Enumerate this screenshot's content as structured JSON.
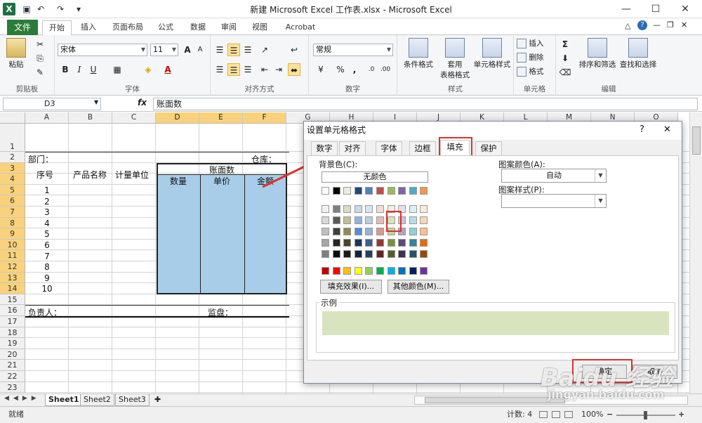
{
  "window": {
    "title": "新建 Microsoft Excel 工作表.xlsx - Microsoft Excel",
    "logo": "X",
    "min": "—",
    "max": "☐",
    "close": "✕"
  },
  "ribbon_tabs": [
    "文件",
    "开始",
    "插入",
    "页面布局",
    "公式",
    "数据",
    "审阅",
    "视图",
    "Acrobat"
  ],
  "ribbon": {
    "clipboard": {
      "paste": "粘贴",
      "label": "剪贴板"
    },
    "font": {
      "name": "宋体",
      "size": "11",
      "label": "字体",
      "bold": "B",
      "italic": "I",
      "underline": "U",
      "grow": "A",
      "shrink": "A",
      "fontcolor": "A"
    },
    "align": {
      "label": "对齐方式"
    },
    "number": {
      "format": "常规",
      "label": "数字",
      "percent": "%",
      "comma": ","
    },
    "styles": {
      "cond": "条件格式",
      "table1": "套用",
      "table2": "表格格式",
      "cell": "单元格样式",
      "label": "样式"
    },
    "cells": {
      "insert": "插入",
      "delete": "删除",
      "format": "格式",
      "label": "单元格"
    },
    "editing": {
      "sigma": "Σ",
      "sort": "排序和筛选",
      "find": "查找和选择",
      "label": "编辑"
    }
  },
  "formula_bar": {
    "name": "D3",
    "fx": "fx",
    "value": "账面数"
  },
  "columns": [
    "A",
    "B",
    "C",
    "D",
    "E",
    "F",
    "G",
    "H",
    "I",
    "J",
    "K",
    "L",
    "M",
    "N",
    "O"
  ],
  "rows": [
    "1",
    "2",
    "3",
    "4",
    "5",
    "6",
    "7",
    "8",
    "9",
    "10",
    "11",
    "12",
    "13",
    "14",
    "15",
    "16",
    "17",
    "18",
    "19",
    "20",
    "21",
    "22",
    "23"
  ],
  "sheet": {
    "dept": "部门：",
    "warehouse": "仓库：",
    "seq": "序号",
    "product": "产品名称",
    "unit": "计量单位",
    "book": "账面数",
    "qty": "数量",
    "price": "单价",
    "amount": "金额",
    "numbers": [
      "1",
      "2",
      "3",
      "4",
      "5",
      "6",
      "7",
      "8",
      "9",
      "10"
    ],
    "owner": "负责人：",
    "supervisor": "监盘："
  },
  "sheet_tabs": [
    "Sheet1",
    "Sheet2",
    "Sheet3"
  ],
  "status": {
    "ready": "就绪",
    "count": "计数: 4",
    "zoom": "100%",
    "minus": "−",
    "plus": "+"
  },
  "dialog": {
    "title": "设置单元格格式",
    "help": "?",
    "close": "✕",
    "tabs": [
      "数字",
      "对齐",
      "字体",
      "边框",
      "填充",
      "保护"
    ],
    "bg_label": "背景色(C):",
    "no_color": "无颜色",
    "fill_effects": "填充效果(I)...",
    "more_colors": "其他颜色(M)...",
    "pattern_color_label": "图案颜色(A):",
    "pattern_color_value": "自动",
    "pattern_style_label": "图案样式(P):",
    "sample_label": "示例",
    "sample_color": "#d7e4bd",
    "ok": "确定",
    "cancel": "取消"
  },
  "watermark": {
    "brand": "Baidu 经验",
    "url": "jingyan.baidu.com"
  }
}
